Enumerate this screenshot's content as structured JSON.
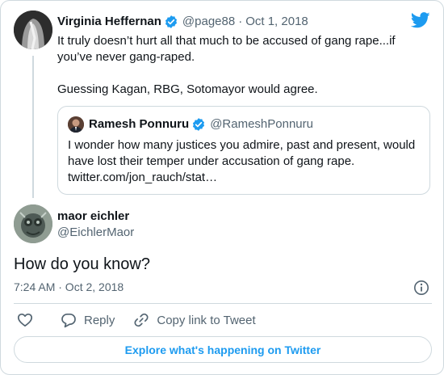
{
  "parent_tweet": {
    "author_name": "Virginia Heffernan",
    "author_handle": "@page88",
    "separator": "·",
    "date": "Oct 1, 2018",
    "text_line_1": "It truly doesn’t hurt all that much to be accused of gang rape...if you’ve never gang-raped.",
    "text_line_2": "Guessing Kagan, RBG, Sotomayor would agree."
  },
  "quoted_tweet": {
    "author_name": "Ramesh Ponnuru",
    "author_handle": "@RameshPonnuru",
    "text": "I wonder how many justices you admire, past and present, would have lost their temper under accusation of gang rape. twitter.com/jon_rauch/stat…"
  },
  "main_tweet": {
    "author_name": "maor eichler",
    "author_handle": "@EichlerMaor",
    "text": "How do you know?",
    "timestamp": "7:24 AM · Oct 2, 2018"
  },
  "actions": {
    "reply_label": "Reply",
    "copy_link_label": "Copy link to Tweet"
  },
  "explore_label": "Explore what's happening on Twitter",
  "icons": {
    "verified": "verified-badge-icon",
    "brand": "twitter-bird-icon",
    "like": "heart-icon",
    "reply": "reply-bubble-icon",
    "copy_link": "link-icon",
    "info": "info-icon"
  },
  "colors": {
    "accent": "#1d9bf0",
    "text": "#0f1419",
    "secondary": "#536471",
    "border": "#cfd9de"
  }
}
